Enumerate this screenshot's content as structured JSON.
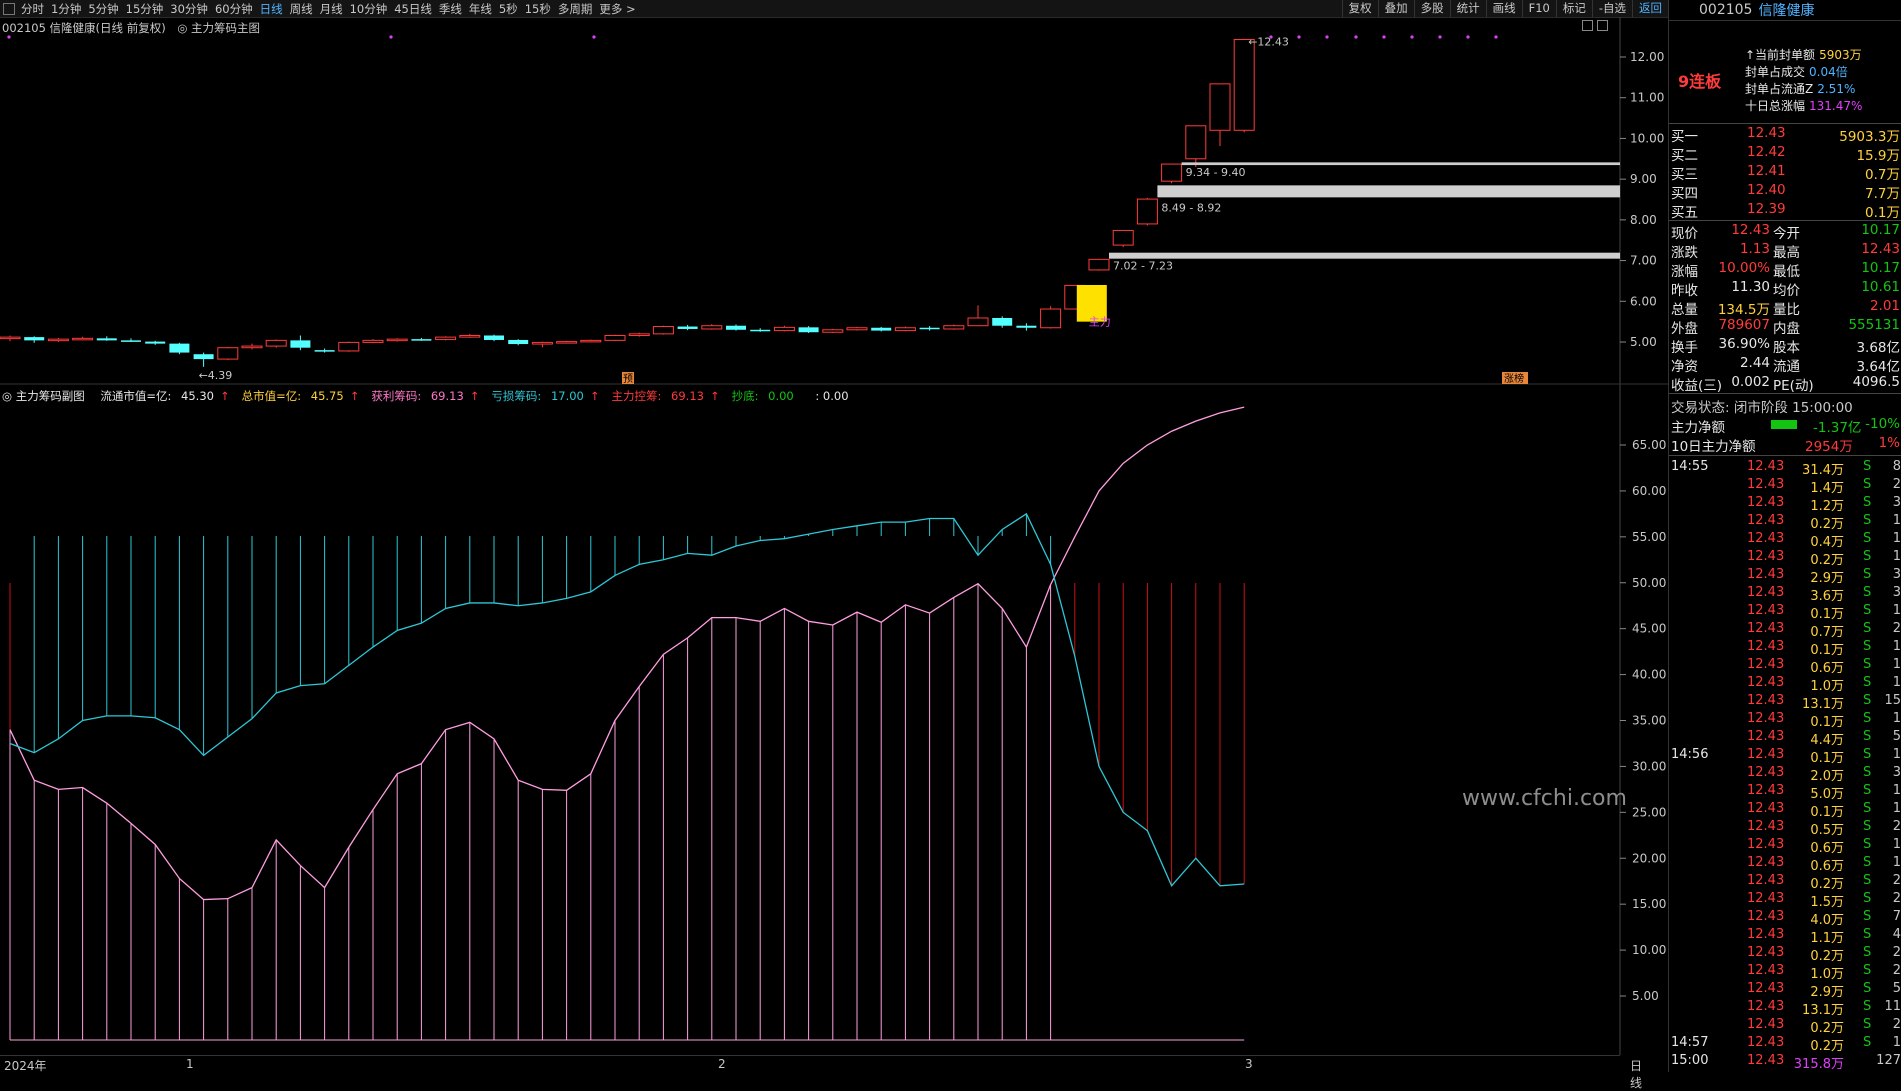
{
  "toolbar": {
    "periods": [
      "分时",
      "1分钟",
      "5分钟",
      "15分钟",
      "30分钟",
      "60分钟",
      "日线",
      "周线",
      "月线",
      "10分钟",
      "45日线",
      "季线",
      "年线",
      "5秒",
      "15秒",
      "多周期",
      "更多 >"
    ],
    "active_period": "日线",
    "right_buttons": [
      "复权",
      "叠加",
      "多股",
      "统计",
      "画线",
      "F10",
      "标记",
      "-自选",
      "返回"
    ]
  },
  "main_chart": {
    "title": "002105 信隆健康(日线 前复权)",
    "indicator": "主力筹码主图",
    "y_ticks": [
      "12.00",
      "11.00",
      "10.00",
      "9.00",
      "8.00",
      "7.00",
      "6.00",
      "5.00"
    ],
    "high_label": "12.43",
    "low_label": "4.39",
    "zones": [
      "9.34 - 9.40",
      "8.49 - 8.92",
      "7.02 - 7.23"
    ],
    "marker_label": "主力",
    "tags": [
      "预",
      "涨榜"
    ],
    "chart_data": {
      "type": "candlestick",
      "ylim": [
        4.6,
        12.6
      ],
      "candles": [
        [
          5.1,
          5.16,
          5.02,
          5.12
        ],
        [
          5.12,
          5.14,
          4.98,
          5.04
        ],
        [
          5.04,
          5.1,
          5.0,
          5.07
        ],
        [
          5.07,
          5.13,
          5.05,
          5.09
        ],
        [
          5.09,
          5.14,
          5.03,
          5.04
        ],
        [
          5.04,
          5.09,
          5.0,
          5.01
        ],
        [
          5.01,
          5.03,
          4.93,
          4.96
        ],
        [
          4.96,
          4.98,
          4.7,
          4.74
        ],
        [
          4.7,
          4.74,
          4.39,
          4.58
        ],
        [
          4.58,
          4.88,
          4.56,
          4.86
        ],
        [
          4.86,
          4.96,
          4.82,
          4.9
        ],
        [
          4.9,
          5.06,
          4.86,
          5.04
        ],
        [
          5.04,
          5.16,
          4.8,
          4.86
        ],
        [
          4.8,
          4.84,
          4.74,
          4.78
        ],
        [
          4.78,
          5.01,
          4.76,
          4.99
        ],
        [
          4.99,
          5.07,
          4.97,
          5.04
        ],
        [
          5.04,
          5.09,
          5.01,
          5.07
        ],
        [
          5.07,
          5.1,
          5.03,
          5.06
        ],
        [
          5.06,
          5.14,
          5.04,
          5.12
        ],
        [
          5.12,
          5.2,
          5.1,
          5.16
        ],
        [
          5.16,
          5.18,
          5.02,
          5.05
        ],
        [
          5.05,
          5.07,
          4.92,
          4.95
        ],
        [
          4.95,
          5.01,
          4.87,
          4.99
        ],
        [
          4.99,
          5.03,
          4.97,
          5.01
        ],
        [
          5.01,
          5.06,
          4.99,
          5.04
        ],
        [
          5.04,
          5.18,
          5.02,
          5.16
        ],
        [
          5.16,
          5.23,
          5.13,
          5.2
        ],
        [
          5.2,
          5.4,
          5.18,
          5.38
        ],
        [
          5.38,
          5.42,
          5.29,
          5.32
        ],
        [
          5.32,
          5.44,
          5.3,
          5.4
        ],
        [
          5.4,
          5.43,
          5.28,
          5.3
        ],
        [
          5.3,
          5.34,
          5.25,
          5.28
        ],
        [
          5.28,
          5.4,
          5.26,
          5.36
        ],
        [
          5.36,
          5.39,
          5.22,
          5.24
        ],
        [
          5.24,
          5.32,
          5.22,
          5.3
        ],
        [
          5.3,
          5.37,
          5.28,
          5.35
        ],
        [
          5.35,
          5.37,
          5.26,
          5.28
        ],
        [
          5.28,
          5.38,
          5.26,
          5.35
        ],
        [
          5.35,
          5.39,
          5.28,
          5.32
        ],
        [
          5.32,
          5.43,
          5.3,
          5.4
        ],
        [
          5.4,
          5.9,
          5.39,
          5.59
        ],
        [
          5.59,
          5.63,
          5.35,
          5.4
        ],
        [
          5.4,
          5.46,
          5.28,
          5.35
        ],
        [
          5.35,
          5.88,
          5.33,
          5.81
        ],
        [
          5.81,
          6.4,
          5.8,
          6.39
        ],
        [
          6.77,
          7.03,
          6.75,
          7.03
        ],
        [
          7.38,
          7.74,
          7.33,
          7.74
        ],
        [
          7.9,
          8.54,
          7.86,
          8.51
        ],
        [
          8.95,
          9.37,
          8.9,
          9.37
        ],
        [
          9.5,
          10.31,
          9.3,
          10.31
        ],
        [
          10.2,
          11.35,
          9.81,
          11.34
        ],
        [
          10.2,
          12.43,
          10.15,
          12.43
        ]
      ]
    }
  },
  "sub_chart": {
    "title": "主力筹码副图",
    "values": [
      {
        "label": "流通市值=亿:",
        "value": "45.30",
        "color": "#e6e6e6"
      },
      {
        "label": "总市值=亿:",
        "value": "45.75",
        "color": "#ffd23d"
      },
      {
        "label": "获利筹码:",
        "value": "69.13",
        "color": "#ff78c8"
      },
      {
        "label": "亏损筹码:",
        "value": "17.00",
        "color": "#2ec7d6"
      },
      {
        "label": "主力控筹:",
        "value": "69.13",
        "color": "#ff3b3b"
      },
      {
        "label": "抄底:",
        "value": "0.00",
        "color": "#13c413"
      },
      {
        "label": "",
        "value": ": 0.00",
        "color": "#e6e6e6"
      }
    ],
    "y_ticks": [
      "65.00",
      "60.00",
      "55.00",
      "50.00",
      "45.00",
      "40.00",
      "35.00",
      "30.00",
      "25.00",
      "20.00",
      "15.00",
      "10.00",
      "5.00"
    ],
    "chart_data": {
      "type": "line",
      "ylim": [
        0,
        70
      ],
      "series": [
        {
          "values": [
            34,
            28.5,
            27.5,
            27.7,
            26,
            23.8,
            21.5,
            17.8,
            15.5,
            15.6,
            16.8,
            22,
            19.2,
            16.8,
            21.2,
            25.3,
            29.2,
            30.3,
            34,
            34.8,
            33,
            28.5,
            27.5,
            27.4,
            29.2,
            35,
            38.7,
            42.2,
            44,
            46.2,
            46.2,
            45.8,
            47.2,
            45.8,
            45.4,
            46.8,
            45.7,
            47.6,
            46.7,
            48.4,
            49.9,
            47.2,
            43,
            49.8,
            55,
            60,
            63,
            65,
            66.5,
            67.6,
            68.5,
            69.13
          ]
        },
        {
          "values": [
            32.5,
            31.5,
            33,
            35,
            35.5,
            35.5,
            35.3,
            34,
            31.2,
            33.2,
            35.2,
            38,
            38.8,
            39,
            41,
            43,
            44.8,
            45.6,
            47.2,
            47.8,
            47.8,
            47.5,
            47.8,
            48.3,
            49,
            50.8,
            52,
            52.5,
            53.2,
            53,
            54,
            54.6,
            54.8,
            55.3,
            55.8,
            56.2,
            56.6,
            56.6,
            57,
            57,
            53,
            55.8,
            57.5,
            52,
            42,
            30,
            25,
            23,
            17,
            20,
            17,
            17.2
          ]
        }
      ]
    }
  },
  "x_axis": {
    "labels": [
      "2024年",
      "1",
      "2",
      "3"
    ],
    "period_label": "日线"
  },
  "right_panel": {
    "code": "002105",
    "name": "信隆健康",
    "board": "9连板",
    "seal_info": [
      {
        "label": "↑当前封单额",
        "value": "5903万",
        "vcolor": "#ffd23d"
      },
      {
        "label": "封单占成交",
        "value": "0.04倍",
        "vcolor": "#4fb3ff"
      },
      {
        "label": "封单占流通Z",
        "value": "2.51%",
        "vcolor": "#4fb3ff"
      },
      {
        "label": "十日总涨幅",
        "value": "131.47%",
        "vcolor": "#e040fb"
      }
    ],
    "bids": [
      {
        "label": "买一",
        "price": "12.43",
        "vol": "5903.3万"
      },
      {
        "label": "买二",
        "price": "12.42",
        "vol": "15.9万"
      },
      {
        "label": "买三",
        "price": "12.41",
        "vol": "0.7万"
      },
      {
        "label": "买四",
        "price": "12.40",
        "vol": "7.7万"
      },
      {
        "label": "买五",
        "price": "12.39",
        "vol": "0.1万"
      }
    ],
    "quote": [
      {
        "l1": "现价",
        "v1": "12.43",
        "c1": "red",
        "l2": "今开",
        "v2": "10.17",
        "c2": "green"
      },
      {
        "l1": "涨跌",
        "v1": "1.13",
        "c1": "red",
        "l2": "最高",
        "v2": "12.43",
        "c2": "red"
      },
      {
        "l1": "涨幅",
        "v1": "10.00%",
        "c1": "red",
        "l2": "最低",
        "v2": "10.17",
        "c2": "green"
      },
      {
        "l1": "昨收",
        "v1": "11.30",
        "c1": "white",
        "l2": "均价",
        "v2": "10.61",
        "c2": "green"
      },
      {
        "l1": "总量",
        "v1": "134.5万",
        "c1": "yellow",
        "l2": "量比",
        "v2": "2.01",
        "c2": "red"
      },
      {
        "l1": "外盘",
        "v1": "789607",
        "c1": "red",
        "l2": "内盘",
        "v2": "555131",
        "c2": "green"
      },
      {
        "l1": "换手",
        "v1": "36.90%",
        "c1": "white",
        "l2": "股本",
        "v2": "3.68亿",
        "c2": "white"
      },
      {
        "l1": "净资",
        "v1": "2.44",
        "c1": "white",
        "l2": "流通",
        "v2": "3.64亿",
        "c2": "white"
      },
      {
        "l1": "收益(三)",
        "v1": "0.002",
        "c1": "white",
        "l2": "PE(动)",
        "v2": "4096.5",
        "c2": "white"
      }
    ],
    "trade_status": "交易状态: 闭市阶段 15:00:00",
    "main_net": {
      "label": "主力净额",
      "value": "-1.37亿",
      "pct": "-10%"
    },
    "main_net_10d": {
      "label": "10日主力净额",
      "value": "2954万",
      "pct": "1%"
    },
    "ticks": [
      {
        "time": "14:55",
        "price": "12.43",
        "vol": "31.4万",
        "side": "S",
        "n": "8"
      },
      {
        "time": "",
        "price": "12.43",
        "vol": "1.4万",
        "side": "S",
        "n": "2"
      },
      {
        "time": "",
        "price": "12.43",
        "vol": "1.2万",
        "side": "S",
        "n": "3"
      },
      {
        "time": "",
        "price": "12.43",
        "vol": "0.2万",
        "side": "S",
        "n": "1"
      },
      {
        "time": "",
        "price": "12.43",
        "vol": "0.4万",
        "side": "S",
        "n": "1"
      },
      {
        "time": "",
        "price": "12.43",
        "vol": "0.2万",
        "side": "S",
        "n": "1"
      },
      {
        "time": "",
        "price": "12.43",
        "vol": "2.9万",
        "side": "S",
        "n": "3"
      },
      {
        "time": "",
        "price": "12.43",
        "vol": "3.6万",
        "side": "S",
        "n": "3"
      },
      {
        "time": "",
        "price": "12.43",
        "vol": "0.1万",
        "side": "S",
        "n": "1"
      },
      {
        "time": "",
        "price": "12.43",
        "vol": "0.7万",
        "side": "S",
        "n": "2"
      },
      {
        "time": "",
        "price": "12.43",
        "vol": "0.1万",
        "side": "S",
        "n": "1"
      },
      {
        "time": "",
        "price": "12.43",
        "vol": "0.6万",
        "side": "S",
        "n": "1"
      },
      {
        "time": "",
        "price": "12.43",
        "vol": "1.0万",
        "side": "S",
        "n": "1"
      },
      {
        "time": "",
        "price": "12.43",
        "vol": "13.1万",
        "side": "S",
        "n": "15"
      },
      {
        "time": "",
        "price": "12.43",
        "vol": "0.1万",
        "side": "S",
        "n": "1"
      },
      {
        "time": "",
        "price": "12.43",
        "vol": "4.4万",
        "side": "S",
        "n": "5"
      },
      {
        "time": "14:56",
        "price": "12.43",
        "vol": "0.1万",
        "side": "S",
        "n": "1"
      },
      {
        "time": "",
        "price": "12.43",
        "vol": "2.0万",
        "side": "S",
        "n": "3"
      },
      {
        "time": "",
        "price": "12.43",
        "vol": "5.0万",
        "side": "S",
        "n": "1"
      },
      {
        "time": "",
        "price": "12.43",
        "vol": "0.1万",
        "side": "S",
        "n": "1"
      },
      {
        "time": "",
        "price": "12.43",
        "vol": "0.5万",
        "side": "S",
        "n": "2"
      },
      {
        "time": "",
        "price": "12.43",
        "vol": "0.6万",
        "side": "S",
        "n": "1"
      },
      {
        "time": "",
        "price": "12.43",
        "vol": "0.6万",
        "side": "S",
        "n": "1"
      },
      {
        "time": "",
        "price": "12.43",
        "vol": "0.2万",
        "side": "S",
        "n": "2"
      },
      {
        "time": "",
        "price": "12.43",
        "vol": "1.5万",
        "side": "S",
        "n": "2"
      },
      {
        "time": "",
        "price": "12.43",
        "vol": "4.0万",
        "side": "S",
        "n": "7"
      },
      {
        "time": "",
        "price": "12.43",
        "vol": "1.1万",
        "side": "S",
        "n": "4"
      },
      {
        "time": "",
        "price": "12.43",
        "vol": "0.2万",
        "side": "S",
        "n": "2"
      },
      {
        "time": "",
        "price": "12.43",
        "vol": "1.0万",
        "side": "S",
        "n": "2"
      },
      {
        "time": "",
        "price": "12.43",
        "vol": "2.9万",
        "side": "S",
        "n": "5"
      },
      {
        "time": "",
        "price": "12.43",
        "vol": "13.1万",
        "side": "S",
        "n": "11"
      },
      {
        "time": "",
        "price": "12.43",
        "vol": "0.2万",
        "side": "S",
        "n": "2"
      },
      {
        "time": "14:57",
        "price": "12.43",
        "vol": "0.2万",
        "side": "S",
        "n": "1"
      },
      {
        "time": "15:00",
        "price": "12.43",
        "vol": "315.8万",
        "side": "",
        "n": "127"
      }
    ]
  },
  "watermark": "www.cfchi.com"
}
